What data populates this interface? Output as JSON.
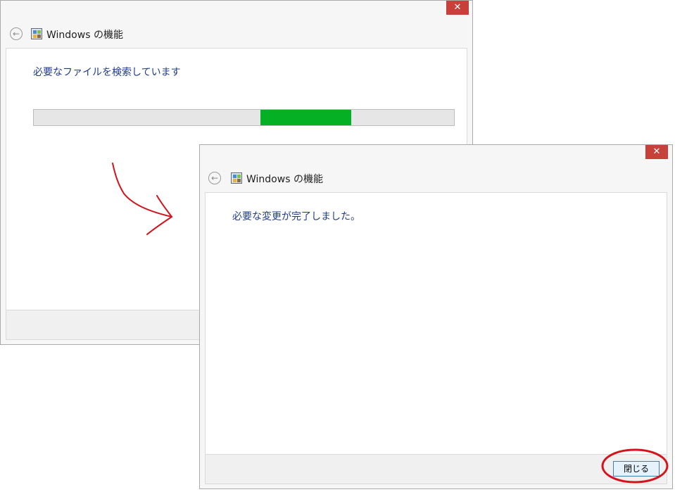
{
  "window_back": {
    "title": "Windows の機能",
    "close_glyph": "✕",
    "back_glyph": "←",
    "status": "必要なファイルを検索しています",
    "progress_segment": {
      "start": 0.54,
      "end": 0.755
    }
  },
  "window_front": {
    "title": "Windows の機能",
    "close_glyph": "✕",
    "back_glyph": "←",
    "status": "必要な変更が完了しました。",
    "close_button_label": "閉じる"
  },
  "colors": {
    "close_red": "#c7413a",
    "status_blue": "#1f3c88",
    "progress_green": "#06b025",
    "annotation_red": "#d4141c"
  },
  "icons": {
    "back": "back-arrow-icon",
    "app": "windows-features-icon",
    "close": "close-icon"
  }
}
